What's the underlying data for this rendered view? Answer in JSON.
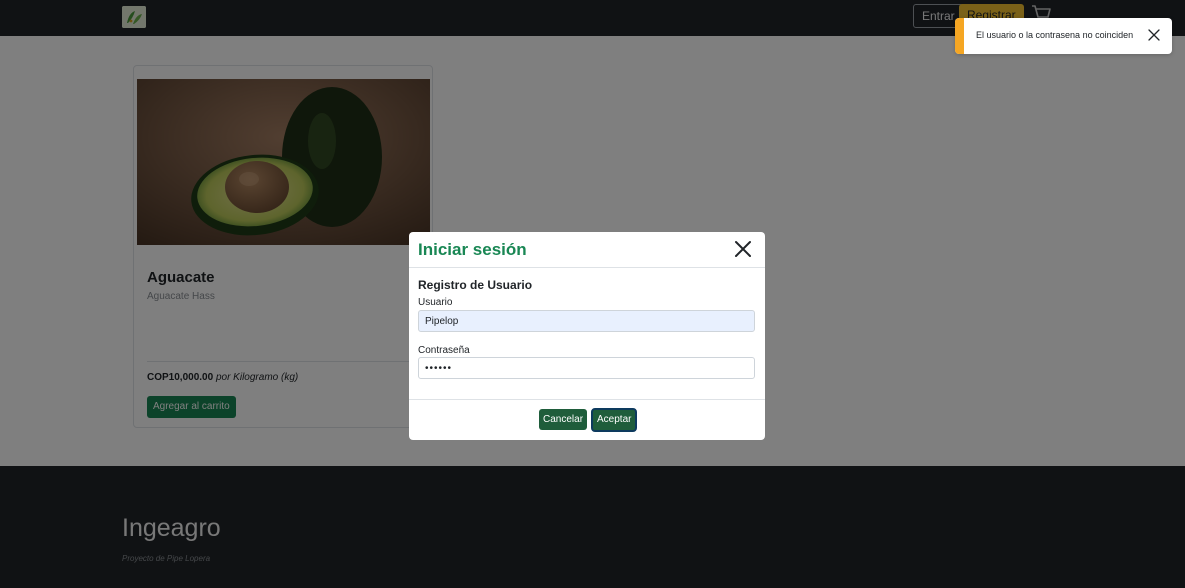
{
  "navbar": {
    "login_label": "Entrar",
    "register_label": "Registrar"
  },
  "product": {
    "name": "Aguacate",
    "variety": "Aguacate Hass",
    "price": "COP10,000.00",
    "unit": "por Kilogramo (kg)",
    "add_to_cart_label": "Agregar al carrito"
  },
  "footer": {
    "brand": "Ingeagro",
    "tagline": "Proyecto de Pipe Lopera"
  },
  "modal": {
    "title": "Iniciar sesión",
    "section_title": "Registro de Usuario",
    "username_label": "Usuario",
    "username_value": "Pipelop",
    "password_label": "Contraseña",
    "password_value": "••••••",
    "cancel_label": "Cancelar",
    "accept_label": "Aceptar"
  },
  "toast": {
    "message": "El usuario o la contrasena no coinciden"
  },
  "colors": {
    "brand_green": "#198754",
    "dark_button": "#1f5d3b",
    "register_yellow": "#f5c230",
    "toast_accent": "#f5a623",
    "navbar_dark": "#212529"
  },
  "icons": {
    "logo": "leaf-logo-icon",
    "cart": "cart-icon",
    "modal_close": "close-icon",
    "toast_close": "close-icon"
  }
}
